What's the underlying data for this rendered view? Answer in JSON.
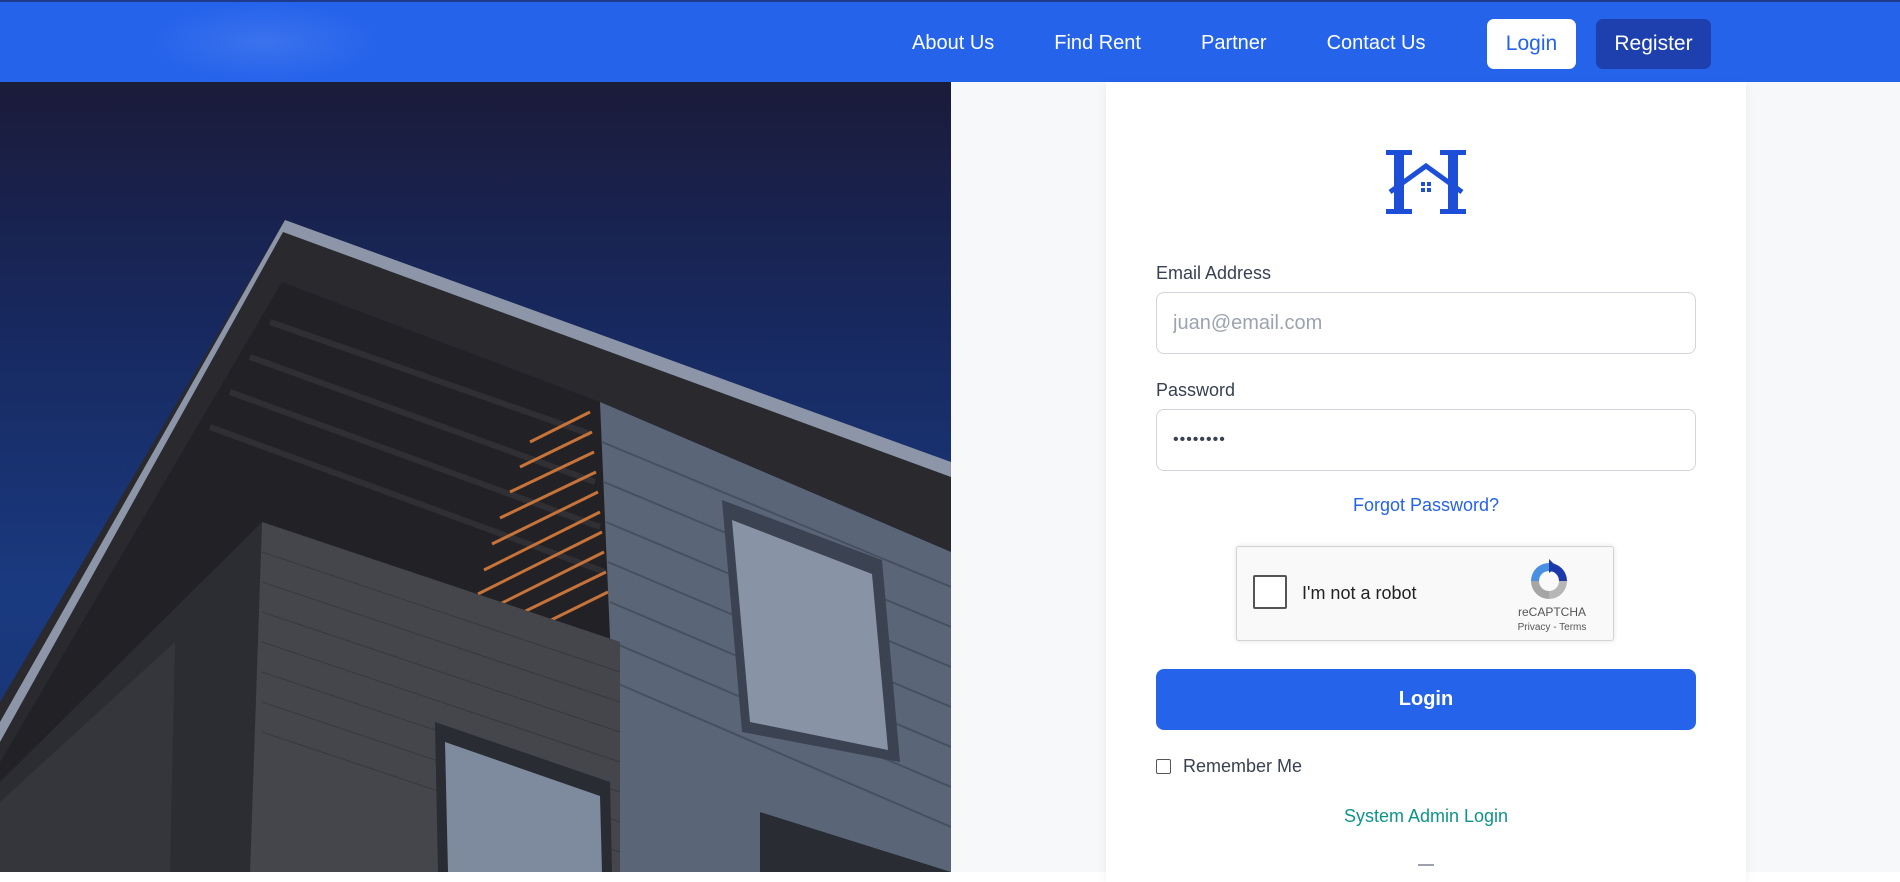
{
  "nav": {
    "links": [
      "About Us",
      "Find Rent",
      "Partner",
      "Contact Us"
    ],
    "login_label": "Login",
    "register_label": "Register"
  },
  "form": {
    "email_label": "Email Address",
    "email_placeholder": "juan@email.com",
    "password_label": "Password",
    "password_value": "••••••••",
    "forgot_label": "Forgot Password?",
    "login_label": "Login",
    "remember_label": "Remember Me",
    "admin_label": "System Admin Login"
  },
  "recaptcha": {
    "text": "I'm not a robot",
    "brand": "reCAPTCHA",
    "links": "Privacy - Terms"
  },
  "colors": {
    "primary": "#2563eb",
    "register": "#1e40af",
    "admin_link": "#0d9488"
  },
  "icons": {
    "brand": "house-h-logo",
    "recaptcha": "recaptcha-logo"
  }
}
